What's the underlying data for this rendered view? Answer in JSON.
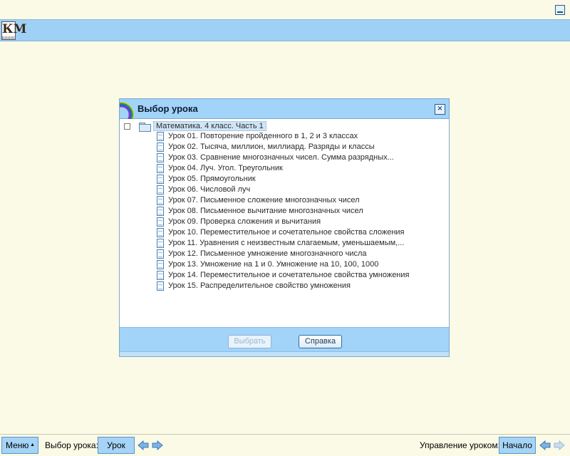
{
  "dialog": {
    "title": "Выбор урока",
    "close_glyph": "×",
    "tree": {
      "root_label": "Математика. 4 класс. Часть 1",
      "lessons": [
        "Урок 01. Повторение пройденного в 1, 2 и 3 классах",
        "Урок 02. Тысяча, миллион, миллиард. Разряды и классы",
        "Урок 03. Сравнение многозначных чисел. Сумма разрядных...",
        "Урок 04. Луч. Угол. Треугольник",
        "Урок 05. Прямоугольник",
        "Урок 06. Числовой луч",
        "Урок 07. Письменное сложение многозначных чисел",
        "Урок 08. Письменное вычитание многозначных чисел",
        "Урок 09. Проверка сложения и вычитания",
        "Урок 10. Переместительное и сочетательное свойства сложения",
        "Урок 11. Уравнения с неизвестным слагаемым, уменьшаемым,...",
        "Урок 12. Письменное умножение многозначного числа",
        "Урок 13. Умножение на 1 и 0. Умножение на 10, 100, 1000",
        "Урок 14. Переместительное и сочетательное свойства умножения",
        "Урок 15. Распределительное свойство умножения"
      ]
    },
    "buttons": {
      "select_label": "Выбрать",
      "help_label": "Справка"
    }
  },
  "statusbar": {
    "menu_label": "Меню",
    "menu_arrow": "▲",
    "lesson_select_label": "Выбор урока:",
    "lesson_button_label": "Урок",
    "lesson_control_label": "Управление уроком:",
    "start_button_label": "Начало"
  },
  "colors": {
    "background": "#fafae6",
    "accent_blue": "#a2d3f8",
    "arrow_blue": "#7eb2e6"
  }
}
